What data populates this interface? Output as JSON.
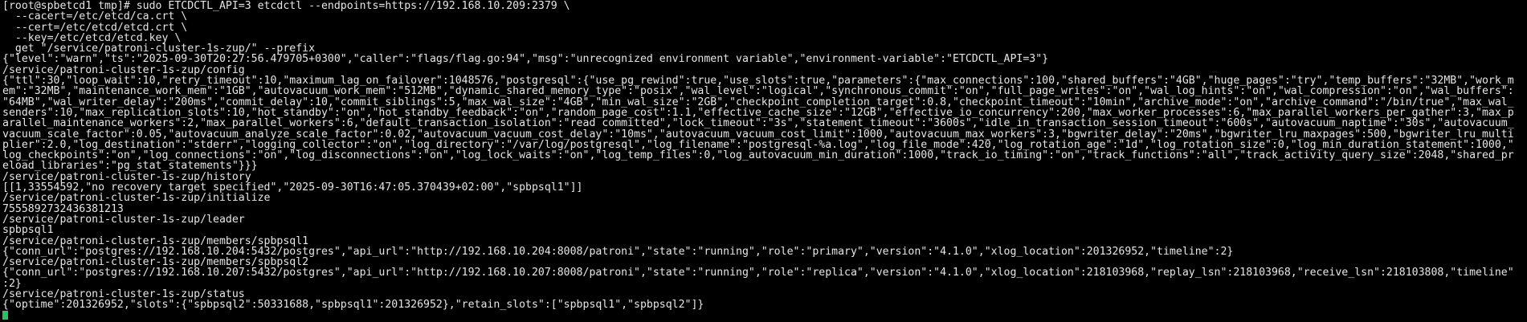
{
  "terminal": {
    "lines": [
      "[root@spbetcd1 tmp]# sudo ETCDCTL_API=3 etcdctl --endpoints=https://192.168.10.209:2379 \\",
      "  --cacert=/etc/etcd/ca.crt \\",
      "  --cert=/etc/etcd/etcd.crt \\",
      "  --key=/etc/etcd/etcd.key \\",
      "  get \"/service/patroni-cluster-1s-zup/\" --prefix",
      "{\"level\":\"warn\",\"ts\":\"2025-09-30T20:27:56.479705+0300\",\"caller\":\"flags/flag.go:94\",\"msg\":\"unrecognized environment variable\",\"environment-variable\":\"ETCDCTL_API=3\"}",
      "/service/patroni-cluster-1s-zup/config",
      "{\"ttl\":30,\"loop_wait\":10,\"retry_timeout\":10,\"maximum_lag_on_failover\":1048576,\"postgresql\":{\"use_pg_rewind\":true,\"use_slots\":true,\"parameters\":{\"max_connections\":100,\"shared_buffers\":\"4GB\",\"huge_pages\":\"try\",\"temp_buffers\":\"32MB\",\"work_m",
      "em\":\"32MB\",\"maintenance_work_mem\":\"1GB\",\"autovacuum_work_mem\":\"512MB\",\"dynamic_shared_memory_type\":\"posix\",\"wal_level\":\"logical\",\"synchronous_commit\":\"on\",\"full_page_writes\":\"on\",\"wal_log_hints\":\"on\",\"wal_compression\":\"on\",\"wal_buffers\":",
      "\"64MB\",\"wal_writer_delay\":\"200ms\",\"commit_delay\":10,\"commit_siblings\":5,\"max_wal_size\":\"4GB\",\"min_wal_size\":\"2GB\",\"checkpoint_completion_target\":0.8,\"checkpoint_timeout\":\"10min\",\"archive_mode\":\"on\",\"archive_command\":\"/bin/true\",\"max_wal_",
      "senders\":10,\"max_replication_slots\":10,\"hot_standby\":\"on\",\"hot_standby_feedback\":\"on\",\"random_page_cost\":1.1,\"effective_cache_size\":\"12GB\",\"effective_io_concurrency\":200,\"max_worker_processes\":6,\"max_parallel_workers_per_gather\":3,\"max_p",
      "arallel_maintenance_workers\":2,\"max_parallel_workers\":6,\"default_transaction_isolation\":\"read committed\",\"lock_timeout\":\"3s\",\"statement_timeout\":\"3600s\",\"idle_in_transaction_session_timeout\":\"600s\",\"autovacuum_naptime\":\"30s\",\"autovacuum_",
      "vacuum_scale_factor\":0.05,\"autovacuum_analyze_scale_factor\":0.02,\"autovacuum_vacuum_cost_delay\":\"10ms\",\"autovacuum_vacuum_cost_limit\":1000,\"autovacuum_max_workers\":3,\"bgwriter_delay\":\"20ms\",\"bgwriter_lru_maxpages\":500,\"bgwriter_lru_multi",
      "plier\":2.0,\"log_destination\":\"stderr\",\"logging_collector\":\"on\",\"log_directory\":\"/var/log/postgresql\",\"log_filename\":\"postgresql-%a.log\",\"log_file_mode\":420,\"log_rotation_age\":\"1d\",\"log_rotation_size\":0,\"log_min_duration_statement\":1000,\"",
      "log_checkpoints\":\"on\",\"log_connections\":\"on\",\"log_disconnections\":\"on\",\"log_lock_waits\":\"on\",\"log_temp_files\":0,\"log_autovacuum_min_duration\":1000,\"track_io_timing\":\"on\",\"track_functions\":\"all\",\"track_activity_query_size\":2048,\"shared_pr",
      "eload_libraries\":\"pg_stat_statements\"}}}",
      "/service/patroni-cluster-1s-zup/history",
      "[[1,33554592,\"no recovery target specified\",\"2025-09-30T16:47:05.370439+02:00\",\"spbpsql1\"]]",
      "/service/patroni-cluster-1s-zup/initialize",
      "7555892732436381213",
      "/service/patroni-cluster-1s-zup/leader",
      "spbpsql1",
      "/service/patroni-cluster-1s-zup/members/spbpsql1",
      "{\"conn_url\":\"postgres://192.168.10.204:5432/postgres\",\"api_url\":\"http://192.168.10.204:8008/patroni\",\"state\":\"running\",\"role\":\"primary\",\"version\":\"4.1.0\",\"xlog_location\":201326952,\"timeline\":2}",
      "/service/patroni-cluster-1s-zup/members/spbpsql2",
      "{\"conn_url\":\"postgres://192.168.10.207:5432/postgres\",\"api_url\":\"http://192.168.10.207:8008/patroni\",\"state\":\"running\",\"role\":\"replica\",\"version\":\"4.1.0\",\"xlog_location\":218103968,\"replay_lsn\":218103968,\"receive_lsn\":218103808,\"timeline\"",
      ":2}",
      "/service/patroni-cluster-1s-zup/status",
      "{\"optime\":201326952,\"slots\":{\"spbpsql2\":50331688,\"spbpsql1\":201326952},\"retain_slots\":[\"spbpsql1\",\"spbpsql2\"]}"
    ],
    "colors": {
      "background": "#000000",
      "foreground": "#e6e6e6",
      "cursor": "#22c55e"
    }
  }
}
